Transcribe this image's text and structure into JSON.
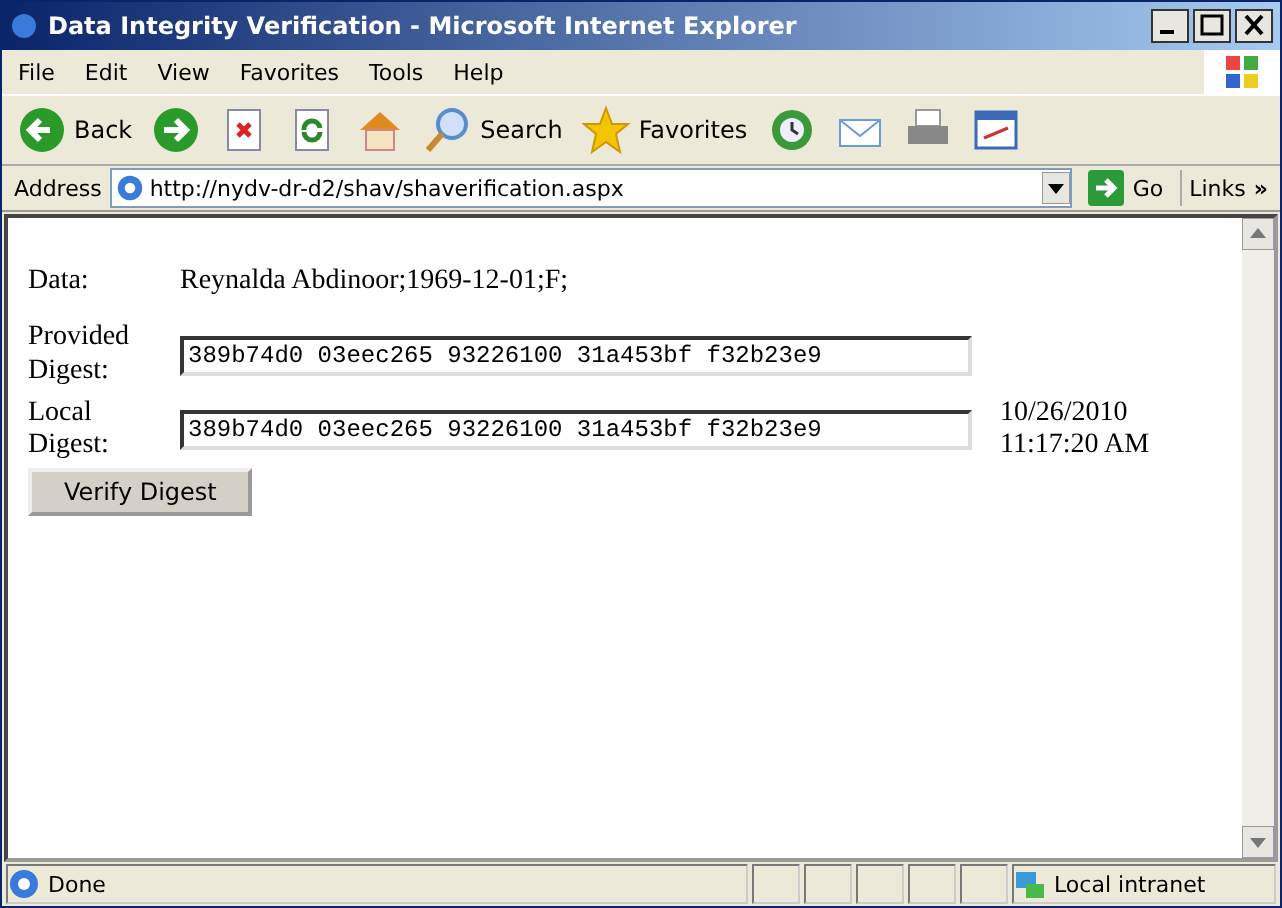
{
  "window": {
    "title": "Data Integrity Verification - Microsoft Internet Explorer"
  },
  "menu": [
    "File",
    "Edit",
    "View",
    "Favorites",
    "Tools",
    "Help"
  ],
  "toolbar": [
    {
      "kind": "back",
      "label": "Back"
    },
    {
      "kind": "forward"
    },
    {
      "kind": "stop"
    },
    {
      "kind": "refresh"
    },
    {
      "kind": "home"
    },
    {
      "kind": "search",
      "label": "Search"
    },
    {
      "kind": "favorites",
      "label": "Favorites"
    },
    {
      "kind": "history"
    },
    {
      "kind": "mail"
    },
    {
      "kind": "print"
    },
    {
      "kind": "edit"
    }
  ],
  "address": {
    "label": "Address",
    "value": "http://nydv-dr-d2/shav/shaverification.aspx",
    "go": "Go",
    "links": "Links",
    "more": "»"
  },
  "form": {
    "data_label": "Data:",
    "data_value": "Reynalda Abdinoor;1969-12-01;F;",
    "provided_label": "Provided Digest:",
    "provided_value": "389b74d0 03eec265 93226100 31a453bf f32b23e9",
    "local_label": "Local Digest:",
    "local_value": "389b74d0 03eec265 93226100 31a453bf f32b23e9",
    "timestamp": "10/26/2010 11:17:20 AM",
    "button": "Verify Digest"
  },
  "status_bar": {
    "text": "Done",
    "zone": "Local intranet"
  }
}
